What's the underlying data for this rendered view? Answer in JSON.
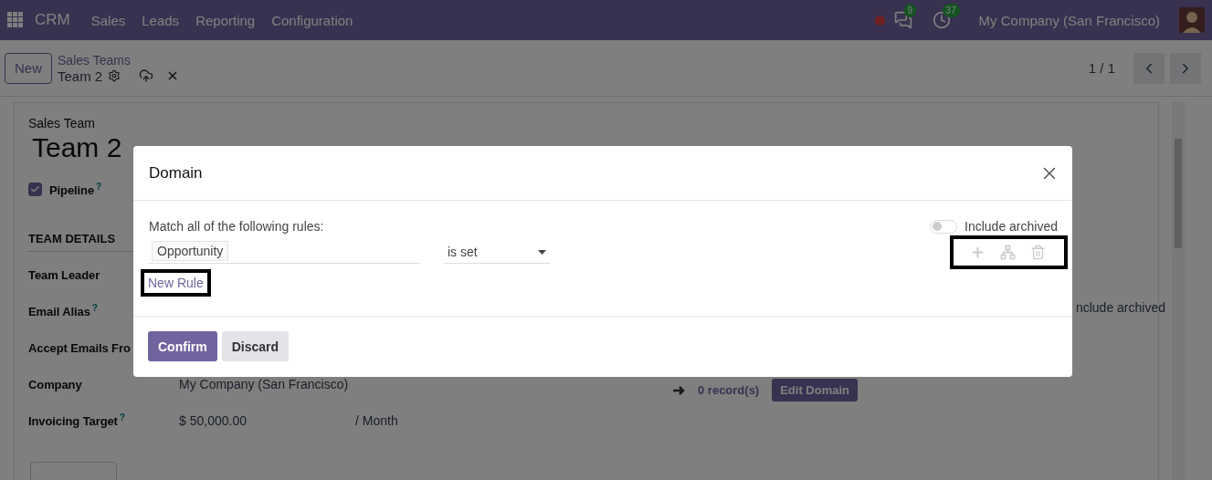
{
  "navbar": {
    "app": "CRM",
    "menu": [
      {
        "label": "Sales"
      },
      {
        "label": "Leads"
      },
      {
        "label": "Reporting"
      },
      {
        "label": "Configuration"
      }
    ],
    "chat_count": "9",
    "activity_count": "37",
    "company": "My Company (San Francisco)"
  },
  "control_panel": {
    "new_button": "New",
    "breadcrumb": "Sales Teams",
    "record": "Team 2",
    "pager": "1 / 1"
  },
  "form": {
    "overline": "Sales Team",
    "title": "Team 2",
    "pipeline": {
      "label": "Pipeline",
      "help": "?",
      "checked": true
    },
    "section": "TEAM DETAILS",
    "fields": [
      {
        "label": "Team Leader"
      },
      {
        "label": "Email Alias",
        "help": "?"
      },
      {
        "label": "Accept Emails Fro"
      },
      {
        "label": "Company",
        "value": "My Company (San Francisco)"
      },
      {
        "label": "Invoicing Target",
        "help": "?",
        "value": "$ 50,000.00",
        "suffix": "/ Month"
      }
    ],
    "domain": {
      "include_archived": "nclude archived",
      "records": "0 record(s)",
      "edit_button": "Edit Domain"
    }
  },
  "dialog": {
    "title": "Domain",
    "match_text": "Match all of the following rules:",
    "include_archived": {
      "label": "Include archived",
      "on": false
    },
    "rule": {
      "field": "Opportunity",
      "operator": "is set"
    },
    "new_rule": "New Rule",
    "buttons": [
      {
        "label": "Confirm",
        "kind": "primary"
      },
      {
        "label": "Discard",
        "kind": "secondary"
      }
    ]
  }
}
